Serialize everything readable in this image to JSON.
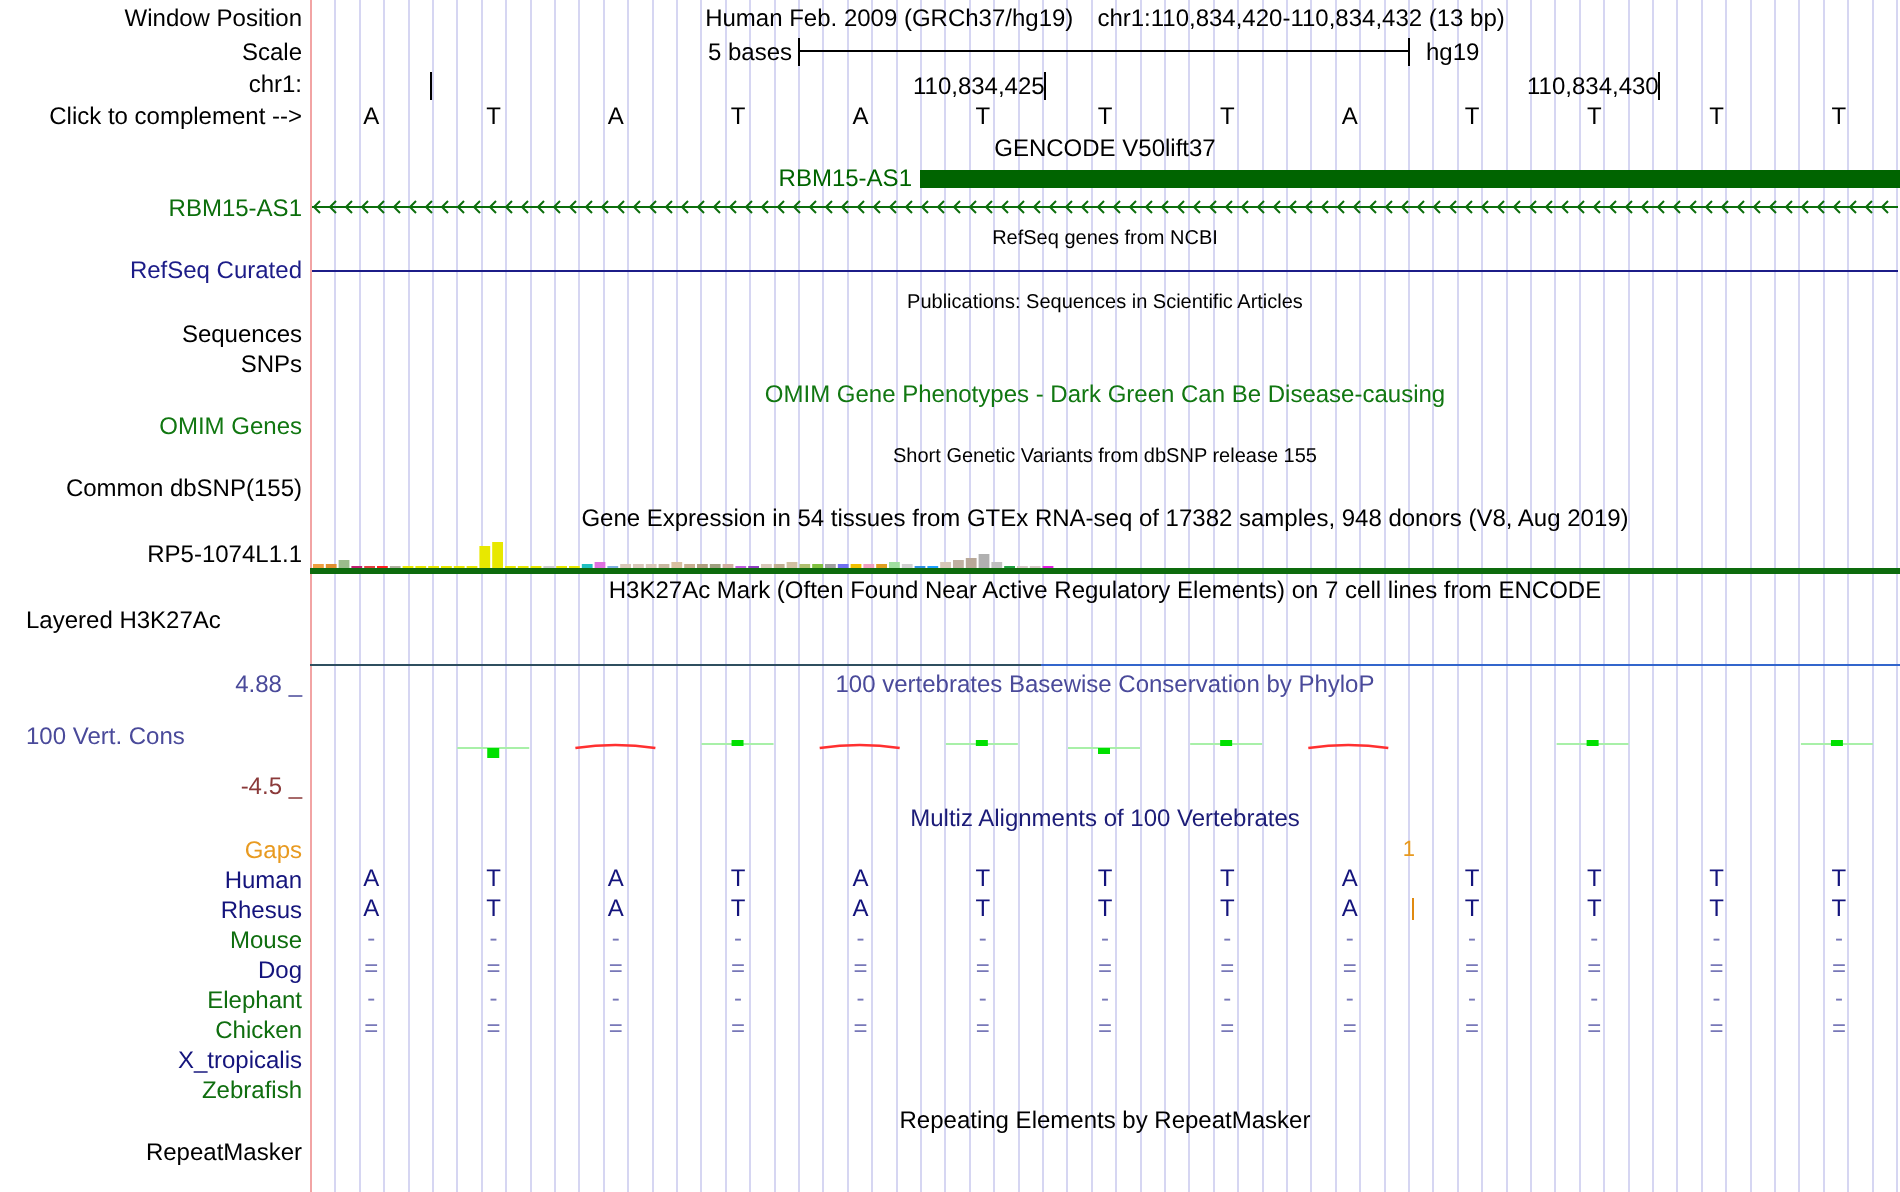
{
  "rows": [
    {
      "kind": "position",
      "label": "Window Position",
      "assembly": "Human Feb. 2009 (GRCh37/hg19)",
      "range": "chr1:110,834,420-110,834,432 (13 bp)"
    },
    {
      "kind": "scale",
      "label": "Scale",
      "scale": "5 bases",
      "db": "hg19"
    },
    {
      "kind": "coords",
      "label": "chr1:",
      "ticks": [
        "110,834,425",
        "110,834,430"
      ]
    },
    {
      "kind": "bases",
      "label": "Click to complement -->",
      "bases": [
        "A",
        "T",
        "A",
        "T",
        "A",
        "T",
        "T",
        "T",
        "A",
        "T",
        "T",
        "T",
        "T"
      ]
    },
    {
      "kind": "title",
      "text": "GENCODE V50lift37",
      "color": "#000000"
    },
    {
      "kind": "gene",
      "name": "RBM15-AS1",
      "color": "#006400"
    },
    {
      "kind": "strand",
      "label": "RBM15-AS1",
      "color": "#0c6e0c"
    },
    {
      "kind": "subtitle",
      "text": "RefSeq genes from NCBI"
    },
    {
      "kind": "line",
      "label": "RefSeq Curated",
      "color": "#1c1c88"
    },
    {
      "kind": "subtitle",
      "text": "Publications: Sequences in Scientific Articles"
    },
    {
      "kind": "label",
      "label": "Sequences",
      "color": "#000000"
    },
    {
      "kind": "label",
      "label": "SNPs",
      "color": "#000000"
    },
    {
      "kind": "title",
      "text": "OMIM Gene Phenotypes - Dark Green Can Be Disease-causing",
      "color": "#117711"
    },
    {
      "kind": "label",
      "label": "OMIM Genes",
      "color": "#117711"
    },
    {
      "kind": "subtitle",
      "text": "Short Genetic Variants from dbSNP release 155"
    },
    {
      "kind": "label",
      "label": "Common dbSNP(155)",
      "color": "#000000"
    },
    {
      "kind": "title",
      "text": "Gene Expression in 54 tissues from GTEx RNA-seq of 17382 samples, 948 donors (V8, Aug 2019)",
      "color": "#000000"
    },
    {
      "kind": "expression",
      "label": "RP5-1074L1.1"
    },
    {
      "kind": "title",
      "text": "H3K27Ac Mark (Often Found Near Active Regulatory Elements) on 7 cell lines from ENCODE",
      "color": "#000000"
    },
    {
      "kind": "layered",
      "label": "Layered H3K27Ac"
    },
    {
      "kind": "wiggle-top",
      "label": "4.88 _",
      "title": "100 vertebrates Basewise Conservation by PhyloP",
      "color": "#4a4a9a"
    },
    {
      "kind": "wiggle-mid",
      "label": "100 Vert. Cons",
      "color": "#4a4a9a"
    },
    {
      "kind": "wiggle-bottom",
      "label": "-4.5 _",
      "color": "#8b3a3a"
    },
    {
      "kind": "title",
      "text": "Multiz Alignments of 100 Vertebrates",
      "color": "#1c1c78"
    },
    {
      "kind": "gaps",
      "label": "Gaps",
      "count": "1",
      "color": "#e89a20"
    },
    {
      "kind": "species",
      "label": "Human",
      "color": "#14147c",
      "aligned": true,
      "gap": false,
      "bases": [
        "A",
        "T",
        "A",
        "T",
        "A",
        "T",
        "T",
        "T",
        "A",
        "T",
        "T",
        "T",
        "T"
      ]
    },
    {
      "kind": "species",
      "label": "Rhesus",
      "color": "#14147c",
      "aligned": true,
      "gap": true,
      "bases": [
        "A",
        "T",
        "A",
        "T",
        "A",
        "T",
        "T",
        "T",
        "A",
        "T",
        "T",
        "T",
        "T"
      ]
    },
    {
      "kind": "species",
      "label": "Mouse",
      "color": "#0f6e0f",
      "aligned": false,
      "gap": false,
      "bases": [
        "-",
        "-",
        "-",
        "-",
        "-",
        "-",
        "-",
        "-",
        "-",
        "-",
        "-",
        "-",
        "-"
      ]
    },
    {
      "kind": "species",
      "label": "Dog",
      "color": "#14147c",
      "aligned": false,
      "gap": false,
      "bases": [
        "=",
        "=",
        "=",
        "=",
        "=",
        "=",
        "=",
        "=",
        "=",
        "=",
        "=",
        "=",
        "="
      ]
    },
    {
      "kind": "species",
      "label": "Elephant",
      "color": "#0f6e0f",
      "aligned": false,
      "gap": false,
      "bases": [
        "-",
        "-",
        "-",
        "-",
        "-",
        "-",
        "-",
        "-",
        "-",
        "-",
        "-",
        "-",
        "-"
      ]
    },
    {
      "kind": "species",
      "label": "Chicken",
      "color": "#0f6e0f",
      "aligned": false,
      "gap": false,
      "bases": [
        "=",
        "=",
        "=",
        "=",
        "=",
        "=",
        "=",
        "=",
        "=",
        "=",
        "=",
        "=",
        "="
      ]
    },
    {
      "kind": "species",
      "label": "X_tropicalis",
      "color": "#14147c",
      "gap": false
    },
    {
      "kind": "species",
      "label": "Zebrafish",
      "color": "#0f6e0f",
      "gap": false
    },
    {
      "kind": "title",
      "text": "Repeating Elements by RepeatMasker",
      "color": "#000000"
    },
    {
      "kind": "label",
      "label": "RepeatMasker",
      "color": "#000000"
    }
  ]
}
